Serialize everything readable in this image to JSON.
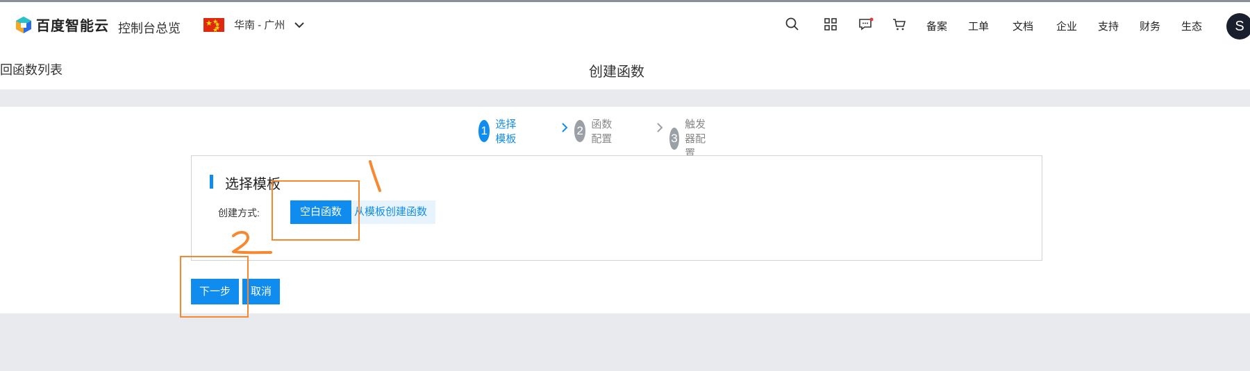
{
  "topnav": {
    "logo_text": "百度智能云",
    "console_label": "控制台总览",
    "region_label": "华南 - 广州",
    "links": [
      "备案",
      "工单",
      "文档",
      "企业",
      "支持",
      "财务",
      "生态"
    ],
    "avatar_letter": "S"
  },
  "subheader": {
    "back_label": "回函数列表",
    "page_title": "创建函数"
  },
  "steps": [
    {
      "num": "1",
      "label": "选择模板",
      "state": "active"
    },
    {
      "num": "2",
      "label": "函数配置",
      "state": "pending"
    },
    {
      "num": "3",
      "label": "触发器配置",
      "state": "pending"
    }
  ],
  "card": {
    "title": "选择模板",
    "field_label": "创建方式:",
    "modes": [
      {
        "label": "空白函数",
        "selected": true
      },
      {
        "label": "从模板创建函数",
        "selected": false
      }
    ]
  },
  "footer": {
    "next_label": "下一步",
    "cancel_label": "取消"
  },
  "annotations": {
    "marks": [
      "1",
      "2"
    ],
    "color": "#f7882f"
  },
  "colors": {
    "accent": "#108cee",
    "step_pending": "#9aa0a6",
    "page_bg": "#e8eaee"
  }
}
